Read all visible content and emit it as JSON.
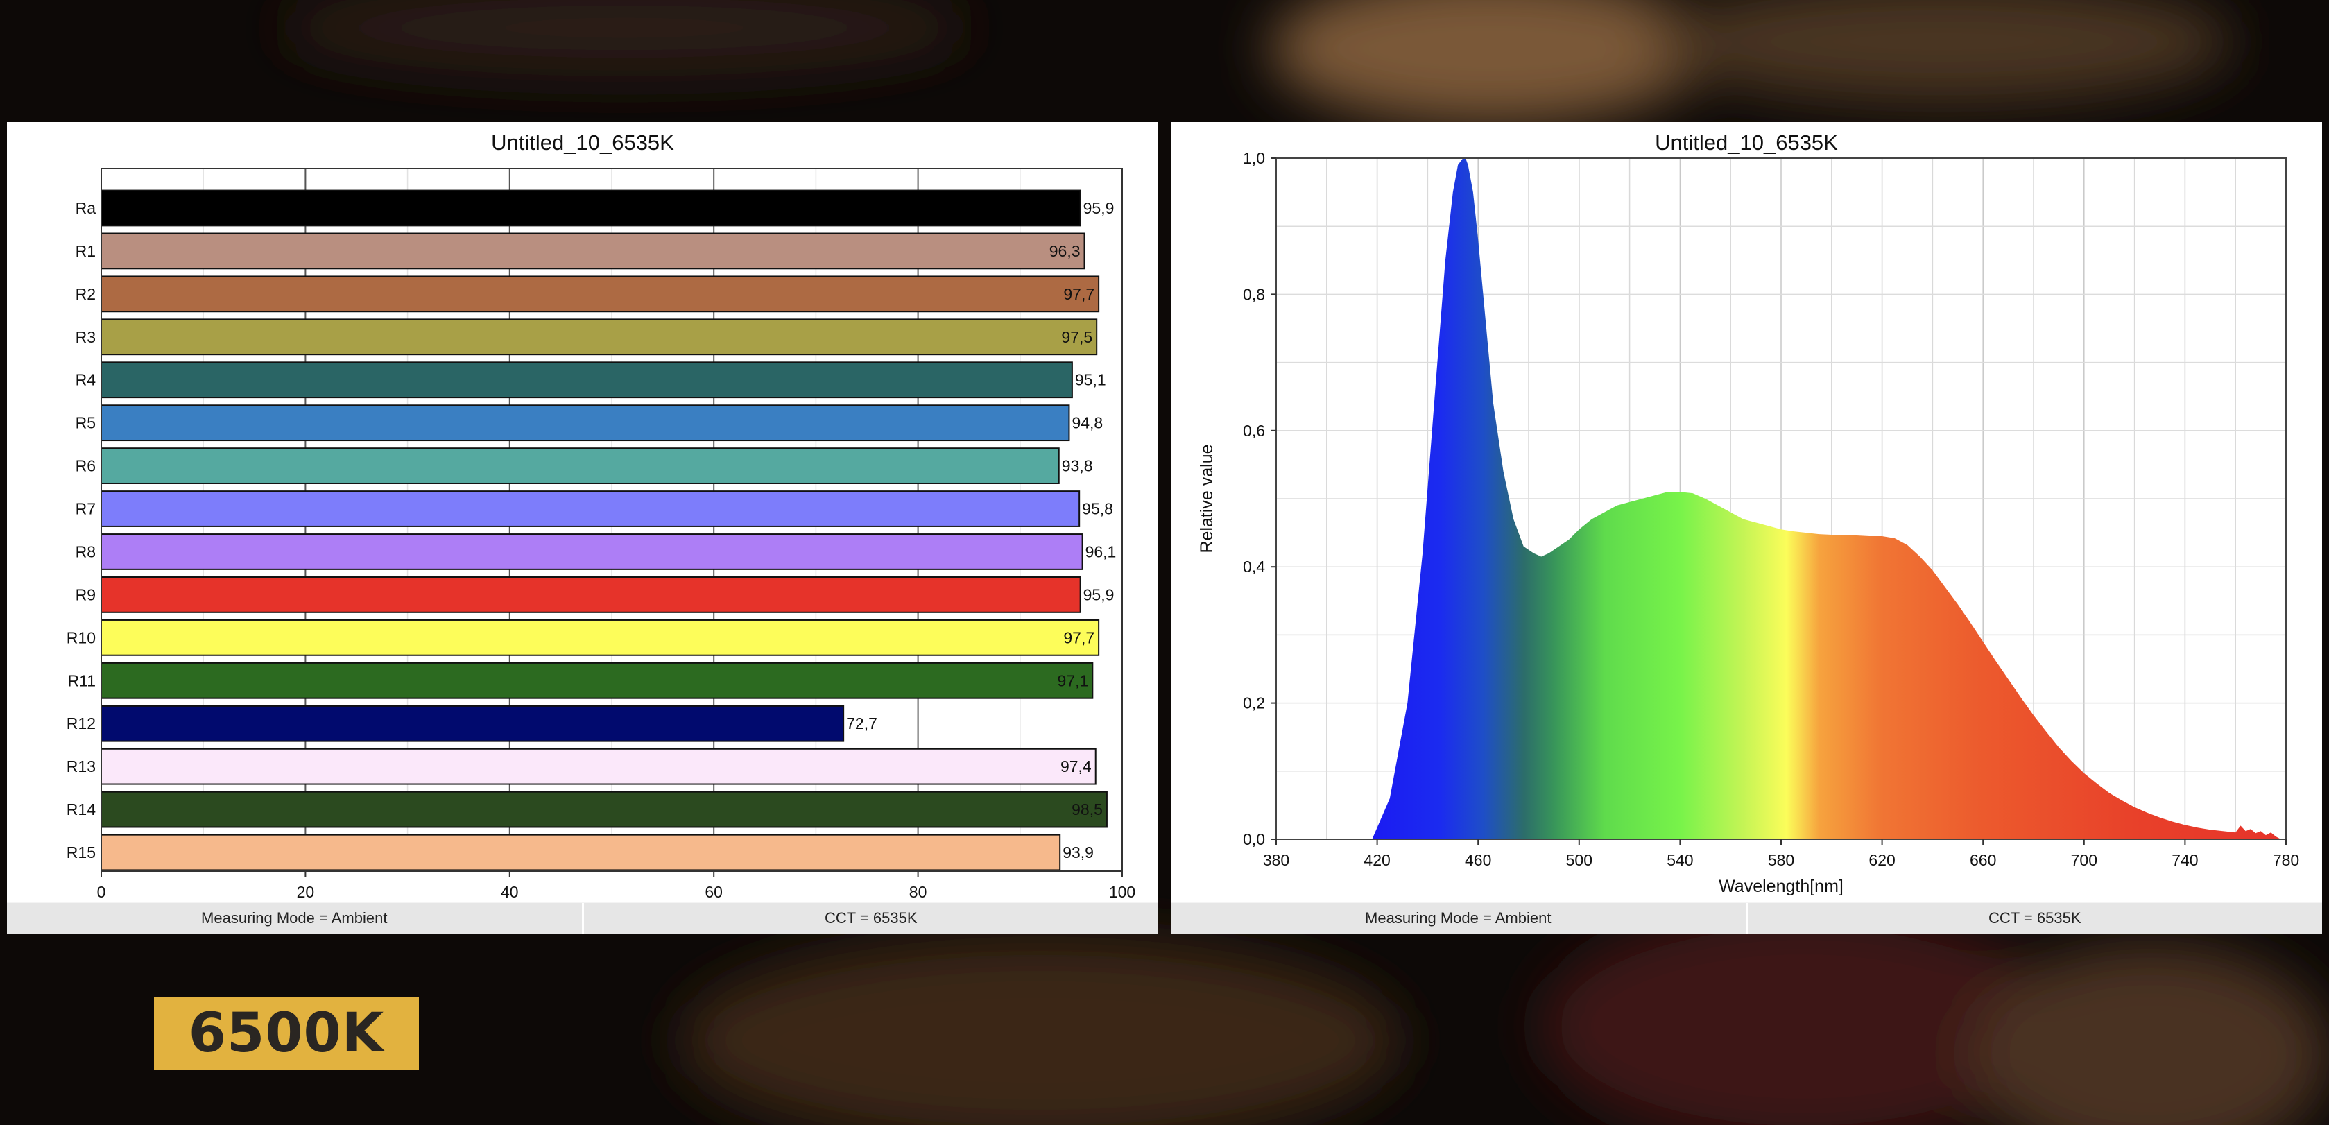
{
  "badge": {
    "label": "6500K"
  },
  "panels": [
    {
      "status_left": "Measuring Mode = Ambient",
      "status_right": "CCT = 6535K"
    },
    {
      "status_left": "Measuring Mode = Ambient",
      "status_right": "CCT = 6535K"
    }
  ],
  "chart_data": [
    {
      "type": "bar",
      "orientation": "horizontal",
      "title": "Untitled_10_6535K",
      "categories": [
        "Ra",
        "R1",
        "R2",
        "R3",
        "R4",
        "R5",
        "R6",
        "R7",
        "R8",
        "R9",
        "R10",
        "R11",
        "R12",
        "R13",
        "R14",
        "R15"
      ],
      "values": [
        95.9,
        96.3,
        97.7,
        97.5,
        95.1,
        94.8,
        93.8,
        95.8,
        96.1,
        95.9,
        97.7,
        97.1,
        72.7,
        97.4,
        98.5,
        93.9
      ],
      "value_labels": [
        "95,9",
        "96,3",
        "97,7",
        "97,5",
        "95,1",
        "94,8",
        "93,8",
        "95,8",
        "96,1",
        "95,9",
        "97,7",
        "97,1",
        "72,7",
        "97,4",
        "98,5",
        "93,9"
      ],
      "colors": [
        "#000000",
        "#b98f80",
        "#ad6a43",
        "#a8a047",
        "#2a6565",
        "#3a7fc2",
        "#55a9a0",
        "#7d7dfb",
        "#ad7ef6",
        "#e6332a",
        "#fdfd5a",
        "#2c6a20",
        "#010a6e",
        "#fbe8fa",
        "#2b4a1f",
        "#f6b98c"
      ],
      "xlim": [
        0,
        100
      ],
      "xticks": [
        0,
        20,
        40,
        60,
        80,
        100
      ],
      "xtick_labels": [
        "0",
        "20",
        "40",
        "60",
        "80",
        "100"
      ],
      "grid": true
    },
    {
      "type": "area",
      "title": "Untitled_10_6535K",
      "xlabel": "Wavelength[nm]",
      "ylabel": "Relative value",
      "xlim": [
        380,
        780
      ],
      "ylim": [
        0,
        1
      ],
      "xticks": [
        380,
        420,
        460,
        500,
        540,
        580,
        620,
        660,
        700,
        740,
        780
      ],
      "xtick_labels": [
        "380",
        "420",
        "460",
        "500",
        "540",
        "580",
        "620",
        "660",
        "700",
        "740",
        "780"
      ],
      "yticks": [
        0,
        0.2,
        0.4,
        0.6,
        0.8,
        1.0
      ],
      "ytick_labels": [
        "0,0",
        "0,2",
        "0,4",
        "0,6",
        "0,8",
        "1,0"
      ],
      "fill": "spectral-gradient",
      "grid": true,
      "x": [
        418,
        425,
        432,
        438,
        443,
        447,
        450,
        452,
        454,
        455,
        456,
        458,
        460,
        463,
        466,
        470,
        474,
        478,
        482,
        485,
        488,
        492,
        496,
        500,
        505,
        510,
        515,
        520,
        525,
        530,
        535,
        540,
        545,
        550,
        555,
        560,
        565,
        570,
        575,
        580,
        585,
        590,
        595,
        600,
        605,
        610,
        615,
        620,
        625,
        630,
        635,
        640,
        645,
        650,
        655,
        660,
        665,
        670,
        675,
        680,
        685,
        690,
        695,
        700,
        705,
        710,
        715,
        720,
        725,
        730,
        735,
        740,
        745,
        750,
        755,
        760,
        762,
        764,
        766,
        768,
        770,
        772,
        774,
        776,
        778
      ],
      "y": [
        0.0,
        0.06,
        0.2,
        0.42,
        0.66,
        0.85,
        0.95,
        0.99,
        1.0,
        1.0,
        0.99,
        0.95,
        0.88,
        0.76,
        0.64,
        0.54,
        0.47,
        0.43,
        0.42,
        0.415,
        0.42,
        0.43,
        0.44,
        0.455,
        0.47,
        0.48,
        0.49,
        0.495,
        0.5,
        0.505,
        0.51,
        0.51,
        0.508,
        0.5,
        0.49,
        0.48,
        0.47,
        0.465,
        0.46,
        0.455,
        0.452,
        0.45,
        0.448,
        0.447,
        0.446,
        0.446,
        0.445,
        0.445,
        0.442,
        0.432,
        0.415,
        0.395,
        0.37,
        0.345,
        0.318,
        0.29,
        0.262,
        0.235,
        0.208,
        0.182,
        0.158,
        0.135,
        0.115,
        0.097,
        0.082,
        0.068,
        0.057,
        0.047,
        0.039,
        0.032,
        0.026,
        0.021,
        0.017,
        0.014,
        0.012,
        0.01,
        0.02,
        0.012,
        0.015,
        0.009,
        0.012,
        0.006,
        0.01,
        0.004,
        0.0
      ]
    }
  ]
}
